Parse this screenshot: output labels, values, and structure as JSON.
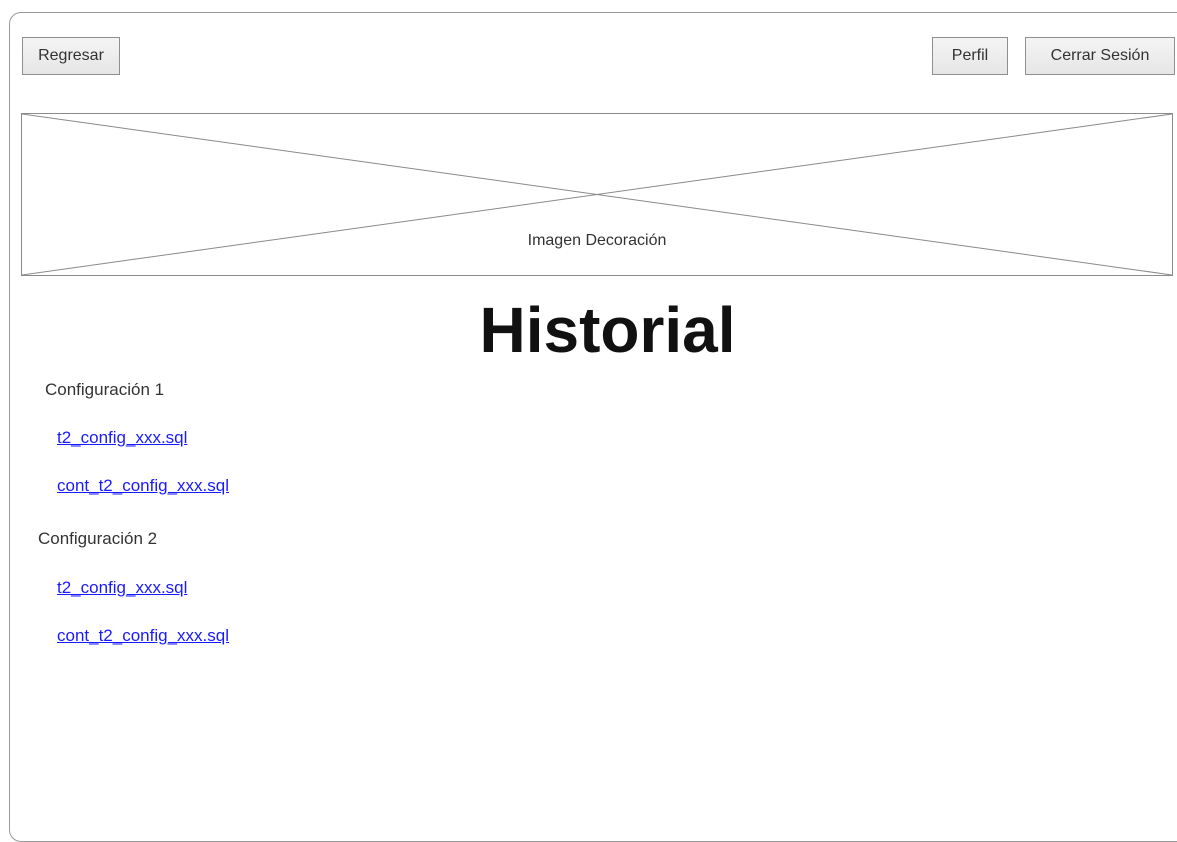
{
  "header": {
    "back_label": "Regresar",
    "profile_label": "Perfil",
    "logout_label": "Cerrar Sesión"
  },
  "banner": {
    "caption": "Imagen Decoración"
  },
  "page": {
    "title": "Historial"
  },
  "groups": [
    {
      "label": "Configuración 1",
      "files": [
        "t2_config_xxx.sql",
        "cont_t2_config_xxx.sql"
      ]
    },
    {
      "label": "Configuración 2",
      "files": [
        "t2_config_xxx.sql",
        "cont_t2_config_xxx.sql"
      ]
    }
  ],
  "colors": {
    "link": "#1a1aff",
    "border": "#8f8f8f"
  }
}
